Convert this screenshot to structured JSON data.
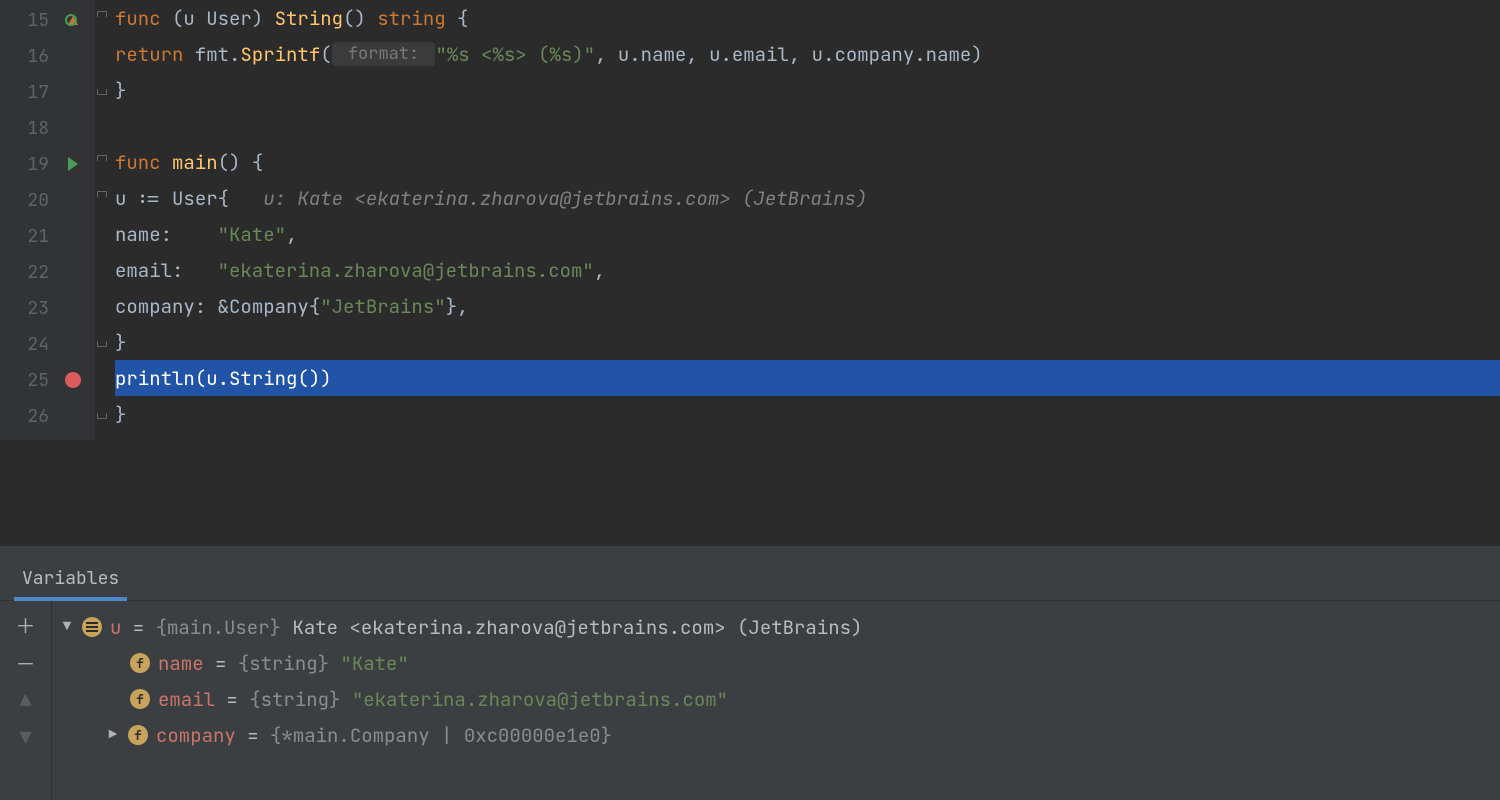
{
  "editor": {
    "lines": [
      {
        "n": 15
      },
      {
        "n": 16
      },
      {
        "n": 17
      },
      {
        "n": 18
      },
      {
        "n": 19
      },
      {
        "n": 20
      },
      {
        "n": 21
      },
      {
        "n": 22
      },
      {
        "n": 23
      },
      {
        "n": 24
      },
      {
        "n": 25
      },
      {
        "n": 26
      }
    ],
    "tokens": {
      "l15_func": "func",
      "l15_recv": " (u User) ",
      "l15_name": "String",
      "l15_sig": "() ",
      "l15_ret": "string",
      "l15_brace": " {",
      "l16_return": "return",
      "l16_pkg": " fmt",
      "l16_dot": ".",
      "l16_fn": "Sprintf",
      "l16_lp": "(",
      "l16_hint": " format: ",
      "l16_str": "\"%s <%s> (%s)\"",
      "l16_args": ", u.name, u.email, u.company.name)",
      "l17_close": "}",
      "l19_func": "func",
      "l19_main": " main",
      "l19_sig": "() {",
      "l20_u": "u ",
      "l20_assign": ":= ",
      "l20_user": "User",
      "l20_brace": "{",
      "l20_hint": "   u: Kate <ekaterina.zharova@jetbrains.com> (JetBrains)",
      "l21_key": "name:    ",
      "l21_val": "\"Kate\"",
      "l21_comma": ",",
      "l22_key": "email:   ",
      "l22_val": "\"ekaterina.zharova@jetbrains.com\"",
      "l22_comma": ",",
      "l23_key": "company: ",
      "l23_amp": "&",
      "l23_type": "Company",
      "l23_brace": "{",
      "l23_val": "\"JetBrains\"",
      "l23_close": "},",
      "l24_close": "}",
      "l25_fn": "println",
      "l25_lp": "(u.",
      "l25_call": "String",
      "l25_rp": "())",
      "l26_close": "}"
    }
  },
  "debug": {
    "tab": "Variables",
    "root": {
      "name": "u",
      "eq": " = ",
      "type": "{main.User}",
      "value": " Kate <ekaterina.zharova@jetbrains.com> (JetBrains)"
    },
    "fields": [
      {
        "name": "name",
        "eq": " = ",
        "type": "{string}",
        "value": " \"Kate\""
      },
      {
        "name": "email",
        "eq": " = ",
        "type": "{string}",
        "value": " \"ekaterina.zharova@jetbrains.com\""
      },
      {
        "name": "company",
        "eq": " = ",
        "type": "{*main.Company | 0xc00000e1e0}",
        "value": ""
      }
    ]
  }
}
